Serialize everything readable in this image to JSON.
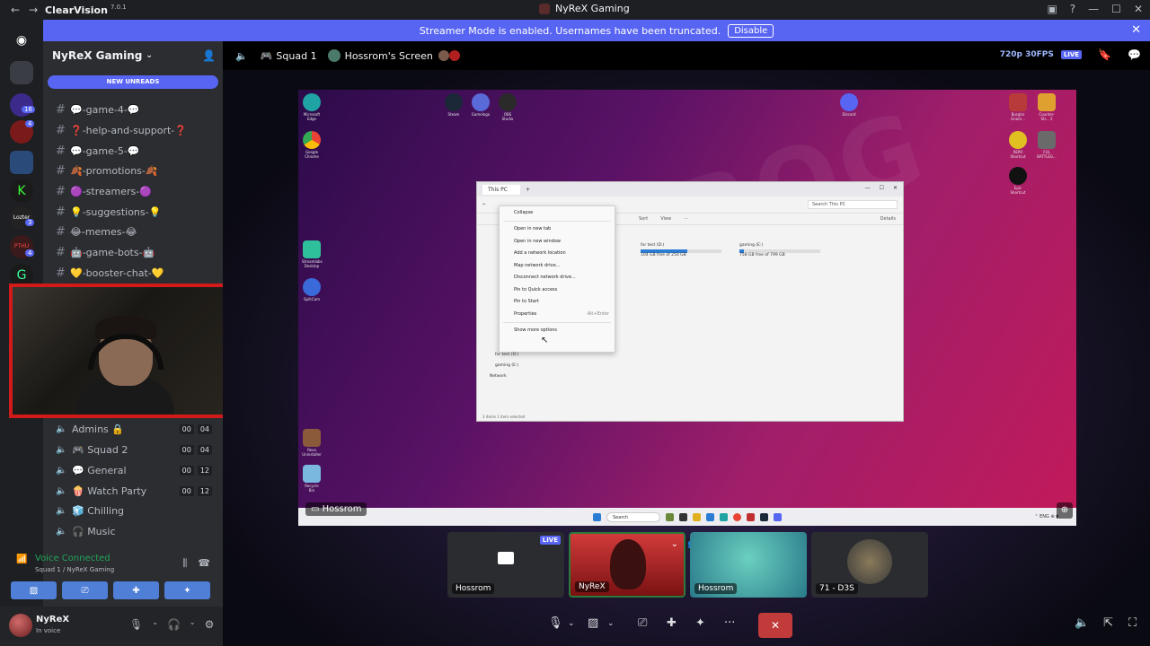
{
  "titlebar": {
    "app_name": "ClearVision",
    "version": "7.0.1",
    "window_title": "NyReX Gaming",
    "back": "←",
    "forward": "→"
  },
  "banner": {
    "text": "Streamer Mode is enabled. Usernames have been truncated.",
    "disable_label": "Disable",
    "close": "✕"
  },
  "server_rail": {
    "badges": [
      "16",
      "4",
      "3",
      "4"
    ]
  },
  "sidebar": {
    "guild_name": "NyReX Gaming",
    "new_unreads": "NEW UNREADS",
    "text_channels": [
      "💬-game-4-💬",
      "❓-help-and-support-❓",
      "💬-game-5-💬",
      "🍂-promotions-🍂",
      "🟣-streamers-🟣",
      "💡-suggestions-💡",
      "😂-memes-😂",
      "🤖-game-bots-🤖",
      "💛-booster-chat-💛"
    ],
    "voice_channels": [
      {
        "name": "Admins 🔒",
        "a": "00",
        "b": "04"
      },
      {
        "name": "🎮 Squad 2",
        "a": "00",
        "b": "04"
      },
      {
        "name": "💬 General",
        "a": "00",
        "b": "12"
      },
      {
        "name": "🍿 Watch Party",
        "a": "00",
        "b": "12"
      },
      {
        "name": "🧊 Chilling",
        "a": "",
        "b": ""
      },
      {
        "name": "🎧 Music",
        "a": "",
        "b": ""
      }
    ],
    "voice_status": "Voice Connected",
    "voice_location": "Squad 1 / NyReX Gaming"
  },
  "user": {
    "name": "NyReX",
    "status": "In voice"
  },
  "stage": {
    "channel": "Squad 1",
    "screen_title": "Hossrom's Screen",
    "quality": "720p 30FPS",
    "live": "LIVE",
    "presenter_tag": "Hossrom"
  },
  "desktop": {
    "icons_left": [
      "Microsoft Edge",
      "Google Chrome",
      "Streamlabs Desktop",
      "SplitCam",
      "Revo Uninstaller",
      "Recycle Bin"
    ],
    "icons_top": [
      "Steam",
      "Gamelogo",
      "OBS Studio"
    ],
    "icons_right": [
      "Discord",
      "Burglar Gnom...",
      "Counter-Str... 2",
      "REPO Shortcut",
      "FUL BATTLEG...",
      "Epic Shortcut"
    ],
    "explorer_title": "This PC",
    "explorer_search": "Search This PC",
    "toolbar": [
      "Sort",
      "View",
      "Details"
    ],
    "drives": [
      {
        "label": "for test (D:)",
        "free": "104 GB free of 250 GB",
        "fill": 0.58
      },
      {
        "label": "gaming (E:)",
        "free": "758 GB free of 799 GB",
        "fill": 0.05
      }
    ],
    "context_menu": [
      {
        "label": "Collapse",
        "kb": ""
      },
      {
        "label": "Open in new tab",
        "kb": ""
      },
      {
        "label": "Open in new window",
        "kb": ""
      },
      {
        "label": "Add a network location",
        "kb": ""
      },
      {
        "label": "Map network drive...",
        "kb": ""
      },
      {
        "label": "Disconnect network drive...",
        "kb": ""
      },
      {
        "label": "Pin to Quick access",
        "kb": ""
      },
      {
        "label": "Pin to Start",
        "kb": ""
      },
      {
        "label": "Properties",
        "kb": "Alt+Enter"
      },
      {
        "label": "Show more options",
        "kb": ""
      }
    ],
    "nav_items": [
      "for test (D:)",
      "gaming (E:)",
      "Network"
    ],
    "status": "3 items  1 item selected",
    "taskbar_search": "Search"
  },
  "tiles": [
    {
      "label": "Hossrom",
      "live": "LIVE"
    },
    {
      "label": "NyReX"
    },
    {
      "label": "Hossrom"
    },
    {
      "label": "71 - D3S"
    }
  ]
}
